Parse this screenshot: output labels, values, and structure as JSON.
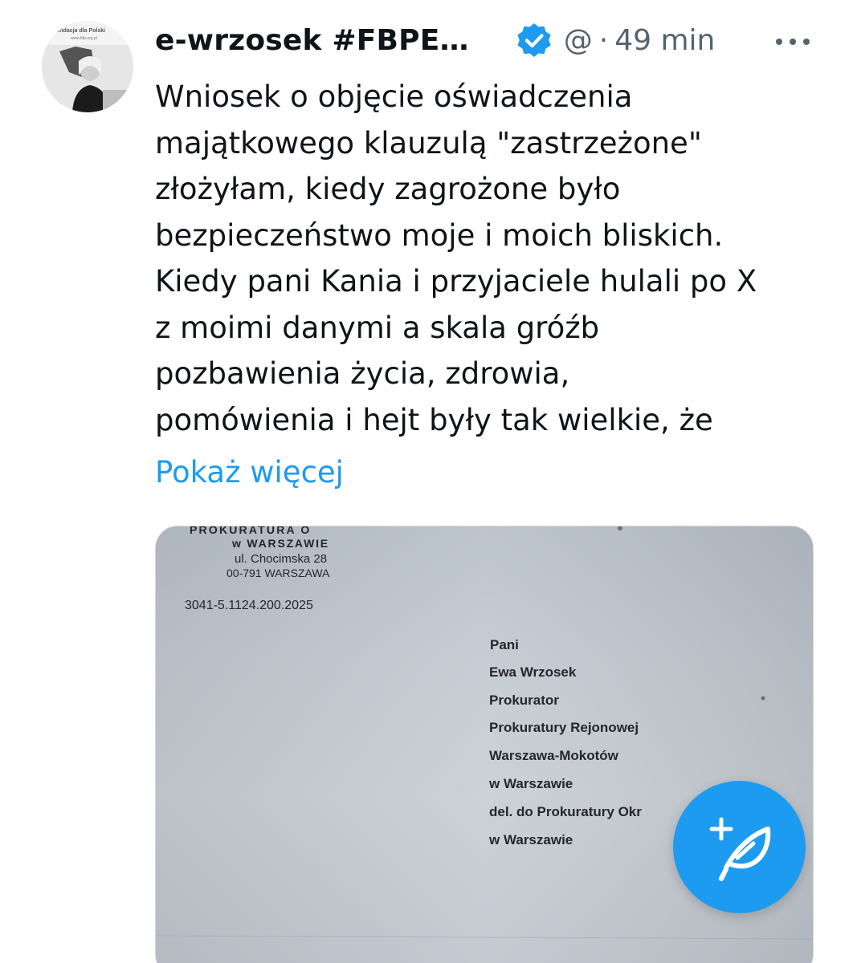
{
  "tweet": {
    "display_name": "e-wrzosek #FBPE…",
    "handle": "@",
    "separator": "·",
    "time": "49 min",
    "text_lines": [
      "Wniosek o objęcie oświadczenia",
      "majątkowego klauzulą \"zastrzeżone\"",
      "złożyłam, kiedy zagrożone było",
      "bezpieczeństwo moje i moich bliskich.",
      "Kiedy pani Kania i przyjaciele hulali po X",
      "z moimi danymi a skala gróźb",
      "pozbawienia życia, zdrowia,",
      "pomówienia i hejt były tak wielkie, że"
    ],
    "show_more": "Pokaż więcej"
  },
  "avatar": {
    "banner_text": "undacja dla Polski",
    "banner_subtext": "www.fdp.org.pl",
    "icon": "profile-photo"
  },
  "document": {
    "header_line1": "PROKURATURA O",
    "header_line2": "w WARSZAWIE",
    "street": "ul. Chocimska 28",
    "postal": "00-791 WARSZAWA",
    "reference": "3041-5.1124.200.2025",
    "addressee": [
      "Pani",
      "Ewa Wrzosek",
      "Prokurator",
      "Prokuratury Rejonowej",
      "Warszawa-Mokotów",
      "w Warszawie",
      "del. do Prokuratury Okr",
      "w Warszawie"
    ]
  },
  "icons": {
    "verified": "verified-badge-icon",
    "more": "more-horizontal-icon",
    "compose": "compose-post-icon"
  },
  "colors": {
    "accent": "#1d9bf0",
    "text": "#0f1419",
    "secondary": "#536471"
  }
}
